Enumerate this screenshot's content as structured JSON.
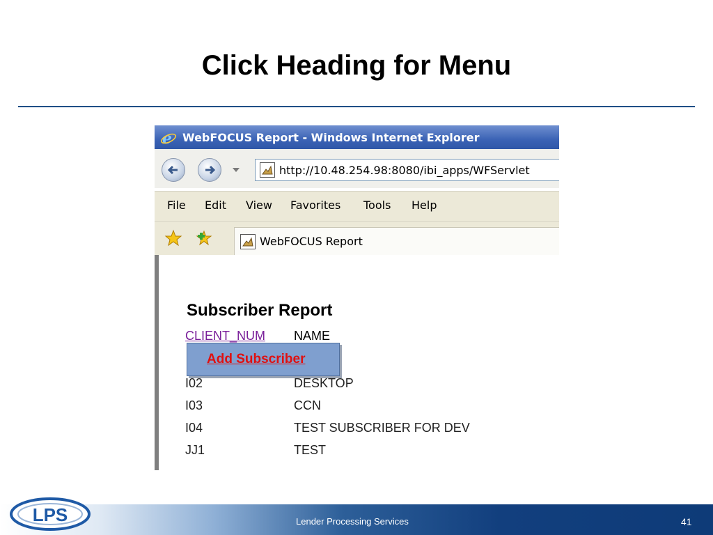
{
  "slide": {
    "title": "Click Heading for Menu",
    "footer_text": "Lender Processing Services",
    "page_number": "41",
    "logo_text": "LPS"
  },
  "browser": {
    "window_title": "WebFOCUS Report - Windows Internet Explorer",
    "address": "http://10.48.254.98:8080/ibi_apps/WFServlet",
    "menu": [
      "File",
      "Edit",
      "View",
      "Favorites",
      "Tools",
      "Help"
    ],
    "tab_title": "WebFOCUS Report"
  },
  "report": {
    "title": "Subscriber Report",
    "headers": {
      "client_num": "CLIENT_NUM",
      "name": "NAME"
    },
    "popup_menu_item": "Add Subscriber",
    "rows": [
      {
        "client_num": "I02",
        "name": "DESKTOP"
      },
      {
        "client_num": "I03",
        "name": "CCN"
      },
      {
        "client_num": "I04",
        "name": "TEST SUBSCRIBER FOR DEV"
      },
      {
        "client_num": "JJ1",
        "name": "TEST"
      }
    ]
  },
  "icons": {
    "ie": "internet-explorer-icon",
    "back": "back-arrow-icon",
    "forward": "forward-arrow-icon",
    "favorites": "favorites-star-icon",
    "add_favorites": "add-favorites-icon",
    "page": "page-icon"
  },
  "colors": {
    "title_rule": "#1f4f86",
    "footer_dark": "#0e3b78",
    "link_header": "#7a1f9a",
    "popup_bg": "#7f9fcf",
    "popup_text": "#e01010"
  }
}
